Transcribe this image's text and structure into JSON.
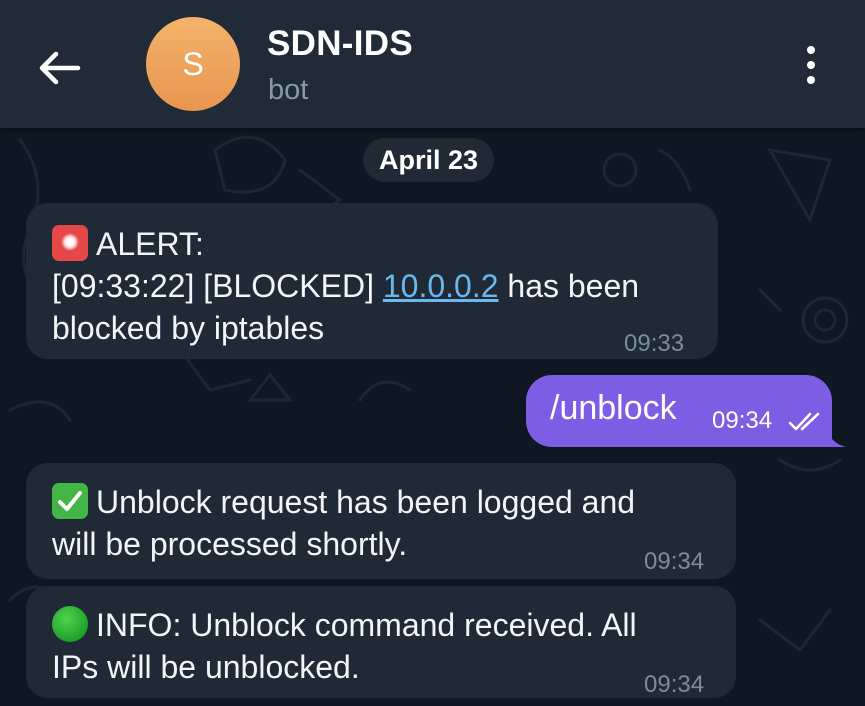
{
  "header": {
    "title": "SDN-IDS",
    "subtitle": "bot",
    "avatar_letter": "S",
    "back_icon": "arrow-left-icon",
    "menu_icon": "vertical-dots-icon"
  },
  "chat": {
    "date_label": "April 23",
    "messages": [
      {
        "direction": "incoming",
        "emoji": "rotating-light",
        "line1": "ALERT:",
        "line2_prefix": "[09:33:22] [BLOCKED] ",
        "line2_link": "10.0.0.2",
        "line2_suffix": " has been",
        "line3": "blocked by iptables",
        "time": "09:33"
      },
      {
        "direction": "outgoing",
        "text": "/unblock",
        "time": "09:34",
        "status": "read"
      },
      {
        "direction": "incoming",
        "emoji": "check-mark-button",
        "line1": "Unblock request has been logged and",
        "line2": "will be processed shortly.",
        "time": "09:34"
      },
      {
        "direction": "incoming",
        "emoji": "green-circle",
        "line1": "INFO: Unblock command received. All",
        "line2": "IPs will be unblocked.",
        "time": "09:34"
      }
    ]
  },
  "colors": {
    "header_bg": "#202b37",
    "chat_bg": "#0f1822",
    "incoming_bubble": "#1f2a36",
    "outgoing_bubble": "#7c5de3",
    "link": "#6cb7ee",
    "avatar": "#ee9f58"
  }
}
